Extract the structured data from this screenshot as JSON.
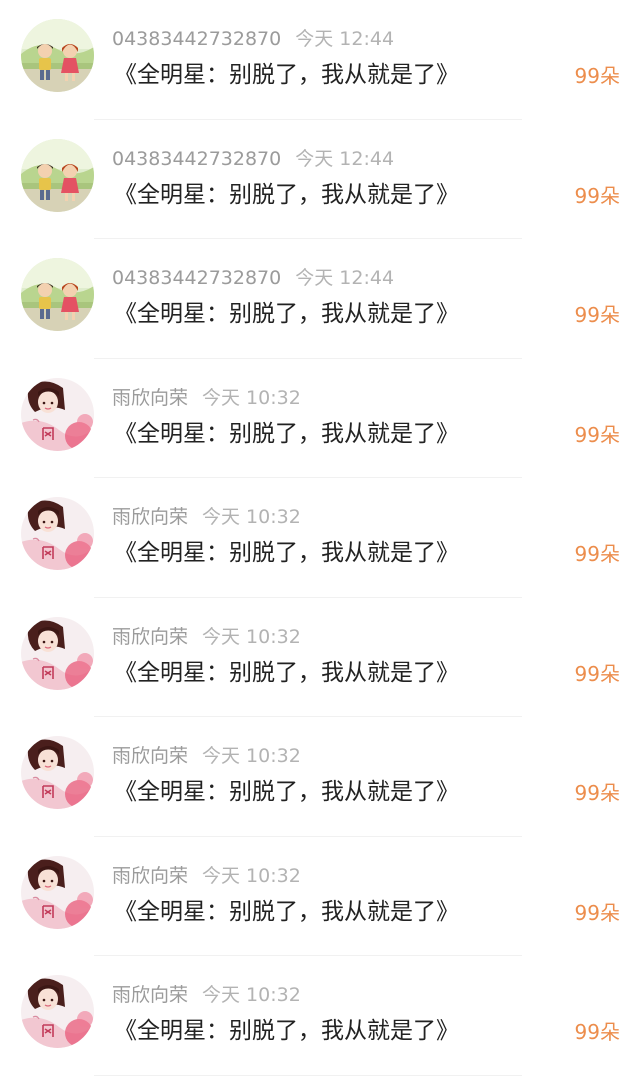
{
  "colors": {
    "username": "#9b9b9b",
    "timestamp": "#b3b3b3",
    "message": "#222222",
    "flower_count": "#ec8d4c"
  },
  "comments": [
    {
      "username": "04383442732870",
      "time": "今天 12:44",
      "text": "《全明星：别脱了，我从就是了》",
      "count": "99朵",
      "avatar": "cartoon-children-avatar"
    },
    {
      "username": "04383442732870",
      "time": "今天 12:44",
      "text": "《全明星：别脱了，我从就是了》",
      "count": "99朵",
      "avatar": "cartoon-children-avatar"
    },
    {
      "username": "04383442732870",
      "time": "今天 12:44",
      "text": "《全明星：别脱了，我从就是了》",
      "count": "99朵",
      "avatar": "cartoon-children-avatar"
    },
    {
      "username": "雨欣向荣",
      "time": "今天 10:32",
      "text": "《全明星：别脱了，我从就是了》",
      "count": "99朵",
      "avatar": "girl-portrait-avatar"
    },
    {
      "username": "雨欣向荣",
      "time": "今天 10:32",
      "text": "《全明星：别脱了，我从就是了》",
      "count": "99朵",
      "avatar": "girl-portrait-avatar"
    },
    {
      "username": "雨欣向荣",
      "time": "今天 10:32",
      "text": "《全明星：别脱了，我从就是了》",
      "count": "99朵",
      "avatar": "girl-portrait-avatar"
    },
    {
      "username": "雨欣向荣",
      "time": "今天 10:32",
      "text": "《全明星：别脱了，我从就是了》",
      "count": "99朵",
      "avatar": "girl-portrait-avatar"
    },
    {
      "username": "雨欣向荣",
      "time": "今天 10:32",
      "text": "《全明星：别脱了，我从就是了》",
      "count": "99朵",
      "avatar": "girl-portrait-avatar"
    },
    {
      "username": "雨欣向荣",
      "time": "今天 10:32",
      "text": "《全明星：别脱了，我从就是了》",
      "count": "99朵",
      "avatar": "girl-portrait-avatar"
    }
  ]
}
